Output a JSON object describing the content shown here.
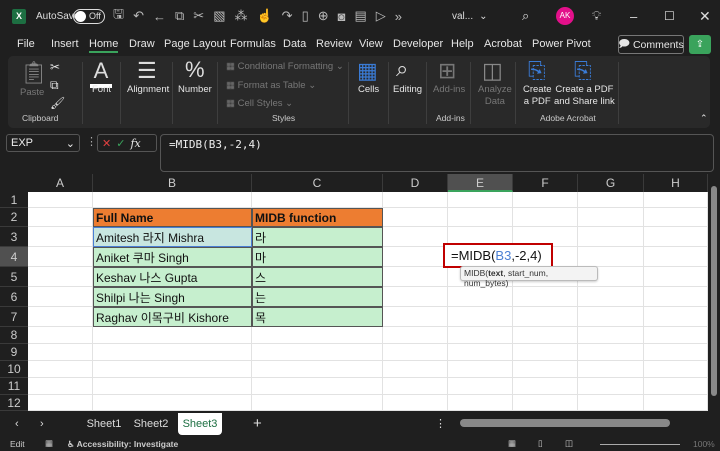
{
  "titlebar": {
    "app_icon": "X",
    "autosave_label": "AutoSave",
    "autosave_state": "Off",
    "filename": "val...",
    "avatar_initials": "AK",
    "more_label": "»"
  },
  "menu": {
    "tabs": [
      "File",
      "Insert",
      "Home",
      "Draw",
      "Page Layout",
      "Formulas",
      "Data",
      "Review",
      "View",
      "Developer",
      "Help",
      "Acrobat",
      "Power Pivot"
    ],
    "active": "Home",
    "comments_label": "Comments"
  },
  "ribbon": {
    "paste": "Paste",
    "clipboard_group": "Clipboard",
    "font": "Font",
    "alignment": "Alignment",
    "number": "Number",
    "conditional_formatting": "Conditional Formatting",
    "format_as_table": "Format as Table",
    "cell_styles": "Cell Styles",
    "styles_group": "Styles",
    "cells": "Cells",
    "editing": "Editing",
    "addins": "Add-ins",
    "addins_group": "Add-ins",
    "analyze_data_1": "Analyze",
    "analyze_data_2": "Data",
    "create_pdf_1": "Create",
    "create_pdf_2": "a PDF",
    "create_share_1": "Create a PDF",
    "create_share_2": "and Share link",
    "adobe_group": "Adobe Acrobat"
  },
  "formula_bar": {
    "name_box": "EXP",
    "formula": "=MIDB(B3,-2,4)"
  },
  "columns": [
    "A",
    "B",
    "C",
    "D",
    "E",
    "F",
    "G",
    "H"
  ],
  "rows": [
    "1",
    "2",
    "3",
    "4",
    "5",
    "6",
    "7",
    "8",
    "9",
    "10",
    "11",
    "12"
  ],
  "table": {
    "headers": [
      "Full Name",
      "MIDB function"
    ],
    "rows": [
      [
        "Amitesh 라지 Mishra",
        "라"
      ],
      [
        "Aniket 쿠마  Singh",
        " 마"
      ],
      [
        "Keshav 나스 Gupta",
        "스"
      ],
      [
        "Shilpi 나는  Singh",
        "는"
      ],
      [
        "Raghav 이목구비 Kishore",
        "목"
      ]
    ]
  },
  "edit_cell": {
    "prefix": "=MIDB(",
    "ref": "B3",
    "suffix": ",-2,4)"
  },
  "tooltip": {
    "func": "MIDB(",
    "arg1": "text",
    "rest": ", start_num, num_bytes)"
  },
  "sheets": [
    "Sheet1",
    "Sheet2",
    "Sheet3"
  ],
  "active_sheet": "Sheet3",
  "status": {
    "mode": "Edit",
    "accessibility": "Accessibility: Investigate",
    "zoom": "100%"
  }
}
